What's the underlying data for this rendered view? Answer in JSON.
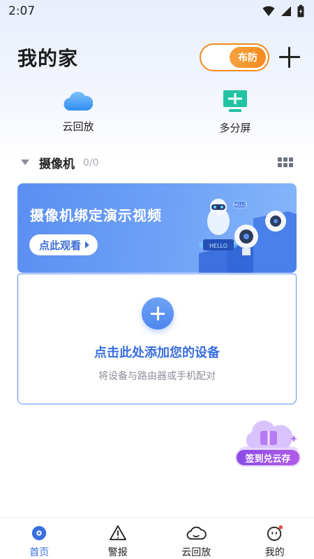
{
  "status": {
    "time": "2:07"
  },
  "header": {
    "title": "我的家",
    "arm_label": "布防"
  },
  "quick": {
    "cloud_label": "云回放",
    "multi_label": "多分屏"
  },
  "section": {
    "title": "摄像机",
    "count": "0/0"
  },
  "banner": {
    "title": "摄像机绑定演示视频",
    "button": "点此观看",
    "robot_badge": "HELLO",
    "robot_sign": "HELLO"
  },
  "add_device": {
    "title": "点击此处添加您的设备",
    "subtitle": "将设备与路由器或手机配对"
  },
  "promo": {
    "label": "签到兑云存"
  },
  "tabs": [
    {
      "label": "首页",
      "icon": "home-icon",
      "active": true
    },
    {
      "label": "警报",
      "icon": "warning-icon",
      "active": false
    },
    {
      "label": "云回放",
      "icon": "cloud-icon",
      "active": false
    },
    {
      "label": "我的",
      "icon": "profile-icon",
      "active": false
    }
  ],
  "colors": {
    "accent": "#3a6fe0",
    "arm": "#f58a1e",
    "promo": "#9b52e8"
  }
}
